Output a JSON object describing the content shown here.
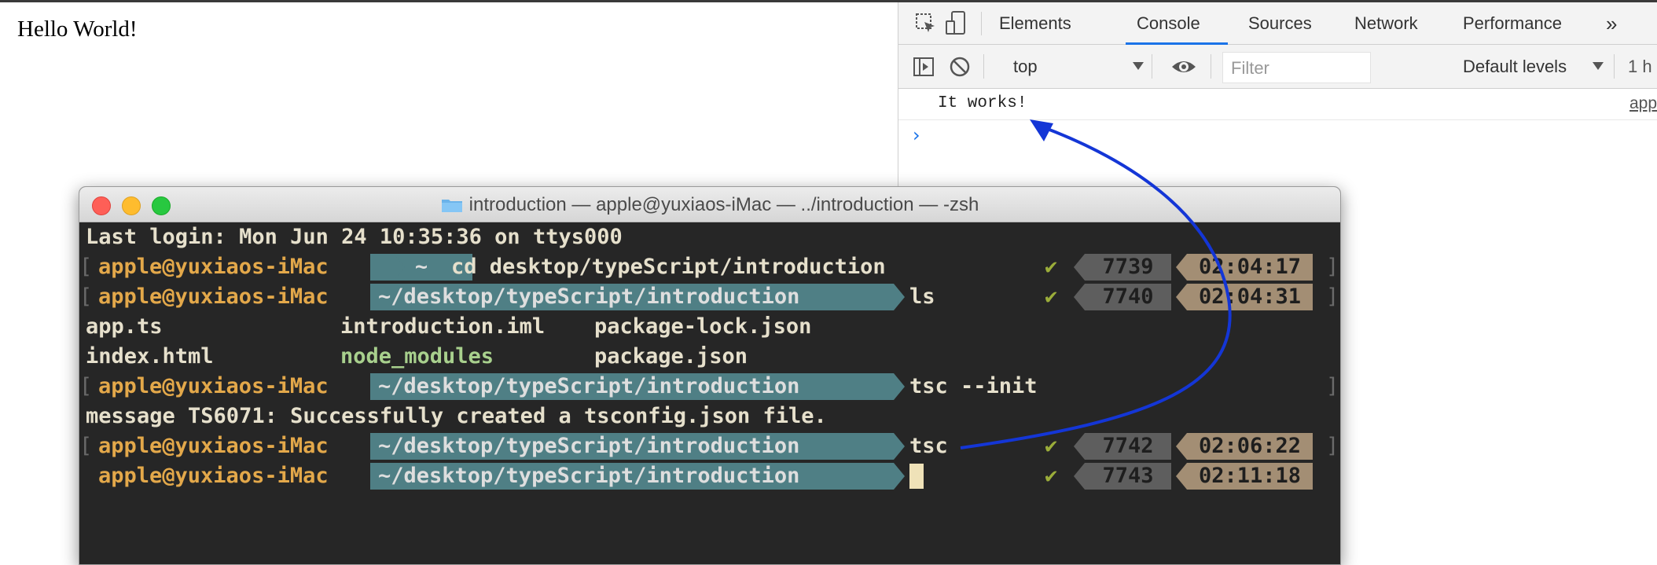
{
  "page": {
    "heading": "Hello World!"
  },
  "devtools": {
    "tabs": [
      "Elements",
      "Console",
      "Sources",
      "Network",
      "Performance"
    ],
    "active_tab": "Console",
    "more_tabs_glyph": "»",
    "toolbar": {
      "context": "top",
      "filter_placeholder": "Filter",
      "levels": "Default levels",
      "hidden_count": "1 h"
    },
    "console": {
      "message": "It works!",
      "source": "app",
      "prompt": "›"
    },
    "accent_color": "#1a73e8"
  },
  "terminal": {
    "title": "introduction — apple@yuxiaos-iMac — ../introduction — -zsh",
    "last_login": "Last login: Mon Jun 24 10:35:36 on ttys000",
    "user": "apple@yuxiaos-iMac",
    "home_dir": "~",
    "dir": "~/desktop/typeScript/introduction",
    "prompts": [
      {
        "cmd": "cd desktop/typeScript/introduction",
        "num": "7739",
        "time": "02:04:17"
      },
      {
        "cmd": "ls",
        "num": "7740",
        "time": "02:04:31"
      },
      {
        "cmd": "tsc --init"
      },
      {
        "cmd": "tsc",
        "num": "7742",
        "time": "02:06:22"
      },
      {
        "cmd": "",
        "num": "7743",
        "time": "02:11:18"
      }
    ],
    "ls_output": {
      "row1": [
        "app.ts",
        "introduction.iml",
        "package-lock.json"
      ],
      "row2": [
        "index.html",
        "node_modules",
        "package.json"
      ]
    },
    "message": "message TS6071: Successfully created a tsconfig.json file.",
    "check_glyph": "✔",
    "colors": {
      "user": "#e3a84a",
      "dir_bg": "#4f7f85",
      "num_bg": "#5e5e5e",
      "time_bg": "#a38e74",
      "node_modules": "#a8d08d"
    }
  },
  "annotation": {
    "arrow_color": "#1436d6"
  }
}
